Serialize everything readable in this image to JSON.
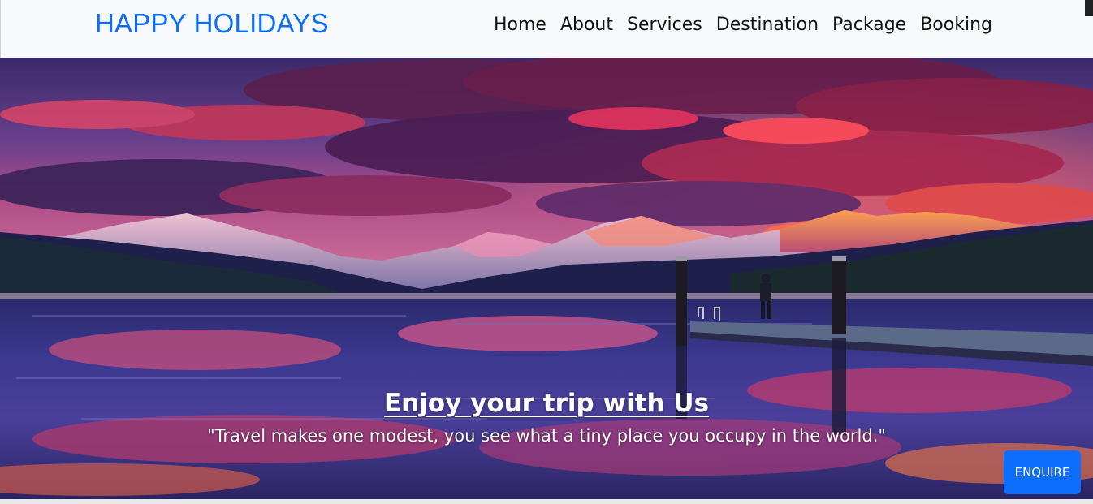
{
  "navbar": {
    "brand": "HAPPY HOLIDAYS",
    "links": [
      "Home",
      "About",
      "Services",
      "Destination",
      "Package",
      "Booking"
    ]
  },
  "hero": {
    "title": "Enjoy your trip with Us",
    "quote": "\"Travel makes one modest, you see what a tiny place you occupy in the world.\"",
    "enquire_label": "ENQUIRE"
  },
  "colors": {
    "brand": "#0d6efd",
    "navbar_bg": "#f8f9fa",
    "button_bg": "#0d6efd"
  }
}
